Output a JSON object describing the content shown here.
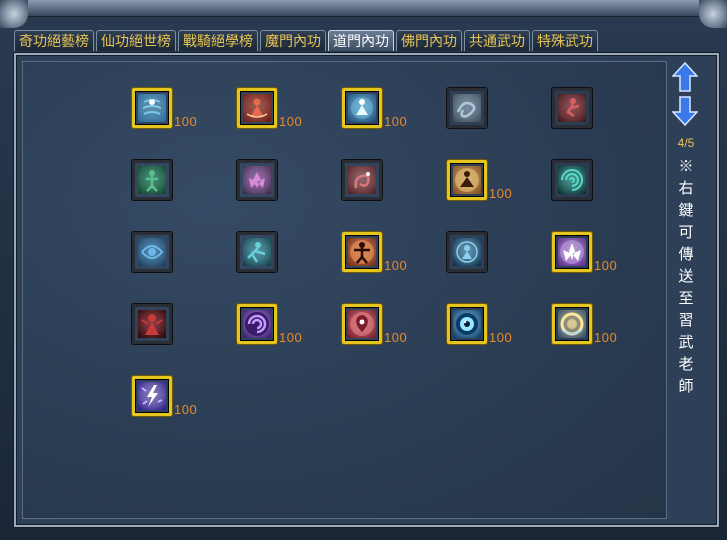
{
  "tabs": [
    {
      "label": "奇功絕藝榜",
      "active": false
    },
    {
      "label": "仙功絕世榜",
      "active": false
    },
    {
      "label": "戰騎絕學榜",
      "active": false
    },
    {
      "label": "魔門內功",
      "active": false
    },
    {
      "label": "道門內功",
      "active": true
    },
    {
      "label": "佛門內功",
      "active": false
    },
    {
      "label": "共通武功",
      "active": false
    },
    {
      "label": "特殊武功",
      "active": false
    }
  ],
  "pager": {
    "indicator": "4/5",
    "up_icon": "arrow-up-icon",
    "down_icon": "arrow-down-icon"
  },
  "note": "※右鍵可傳送至習武老師",
  "colors": {
    "tab_text": "#e8c454",
    "level_text": "#e88a2a",
    "learned_border": "#e6c51e"
  },
  "skills": [
    {
      "icon": "flowing-figure-icon",
      "learned": true,
      "level": "100",
      "palette": [
        "#7ec8e8",
        "#2a6a9a"
      ]
    },
    {
      "icon": "fire-meditation-icon",
      "learned": true,
      "level": "100",
      "palette": [
        "#e86a4a",
        "#6a1a14"
      ]
    },
    {
      "icon": "aura-meditation-icon",
      "learned": true,
      "level": "100",
      "palette": [
        "#8ae0ff",
        "#1a4a7a"
      ]
    },
    {
      "icon": "mist-swirl-icon",
      "learned": false,
      "level": "",
      "palette": [
        "#b0c8d8",
        "#3a4a5a"
      ]
    },
    {
      "icon": "red-dancer-icon",
      "learned": false,
      "level": "",
      "palette": [
        "#d86060",
        "#3a1818"
      ]
    },
    {
      "icon": "jade-figure-icon",
      "learned": false,
      "level": "",
      "palette": [
        "#58c08a",
        "#10402a"
      ]
    },
    {
      "icon": "lotus-blossom-icon",
      "learned": false,
      "level": "",
      "palette": [
        "#d88ad8",
        "#3a2a4a"
      ]
    },
    {
      "icon": "crimson-serpent-icon",
      "learned": false,
      "level": "",
      "palette": [
        "#d87a7a",
        "#4a2020"
      ]
    },
    {
      "icon": "golden-meditation-icon",
      "learned": true,
      "level": "100",
      "palette": [
        "#ffd27a",
        "#8a4a1a"
      ]
    },
    {
      "icon": "teal-vortex-icon",
      "learned": false,
      "level": "",
      "palette": [
        "#5ad8c8",
        "#0a2a2a"
      ]
    },
    {
      "icon": "water-swirl-icon",
      "learned": false,
      "level": "",
      "palette": [
        "#6ab8e8",
        "#1a3a5a"
      ]
    },
    {
      "icon": "teal-warrior-icon",
      "learned": false,
      "level": "",
      "palette": [
        "#6ad0d8",
        "#123a42"
      ]
    },
    {
      "icon": "flame-stance-icon",
      "learned": true,
      "level": "100",
      "palette": [
        "#ff9a5a",
        "#7a2a14"
      ]
    },
    {
      "icon": "blue-sage-icon",
      "learned": false,
      "level": "",
      "palette": [
        "#8ad0f0",
        "#0a2a44"
      ]
    },
    {
      "icon": "violet-lotus-icon",
      "learned": true,
      "level": "100",
      "palette": [
        "#e2b8ff",
        "#5a2a8a"
      ]
    },
    {
      "icon": "shadow-demon-icon",
      "learned": false,
      "level": "",
      "palette": [
        "#c83a3a",
        "#200808"
      ]
    },
    {
      "icon": "purple-spiral-icon",
      "learned": true,
      "level": "100",
      "palette": [
        "#c89aff",
        "#3a1a6a"
      ]
    },
    {
      "icon": "crimson-rune-icon",
      "learned": true,
      "level": "100",
      "palette": [
        "#ff8a8a",
        "#7a1a2a"
      ]
    },
    {
      "icon": "azure-eye-icon",
      "learned": true,
      "level": "100",
      "palette": [
        "#9ae8ff",
        "#0a3a6a"
      ]
    },
    {
      "icon": "golden-ring-icon",
      "learned": true,
      "level": "100",
      "palette": [
        "#ffe8a0",
        "#2a4a6a"
      ]
    },
    {
      "icon": "lightning-figure-icon",
      "learned": true,
      "level": "100",
      "palette": [
        "#c8b0ff",
        "#2a1a8a"
      ]
    }
  ]
}
